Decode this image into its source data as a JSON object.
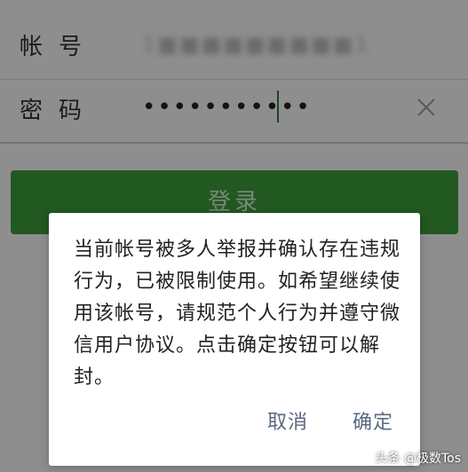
{
  "form": {
    "account_label": "帐号",
    "account_value": "1■■■■■■■■■1",
    "password_label": "密码",
    "password_value": "•••••••••••",
    "clear_icon": "close-icon",
    "login_label": "登录"
  },
  "dialog": {
    "message": "当前帐号被多人举报并确认存在违规行为，已被限制使用。如希望继续使用该帐号，请规范个人行为并遵守微信用户协议。点击确定按钮可以解封。",
    "cancel_label": "取消",
    "confirm_label": "确定"
  },
  "watermark": {
    "text": "头条 @极数Tos"
  },
  "colors": {
    "login_button": "#3a9a3a",
    "dialog_button_text": "#596980",
    "cursor": "#2e7d32"
  }
}
